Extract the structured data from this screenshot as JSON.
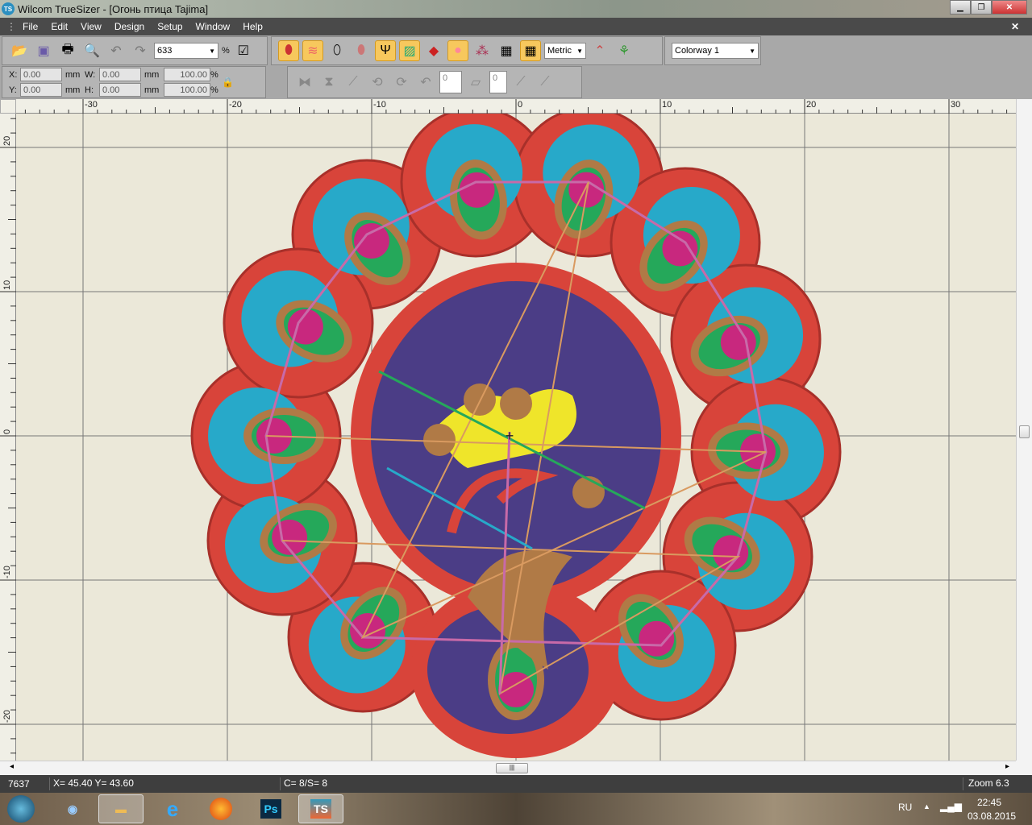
{
  "window": {
    "title": "Wilcom TrueSizer - [Огонь птица          Tajima]",
    "logo": "TS"
  },
  "menu": [
    "File",
    "Edit",
    "View",
    "Design",
    "Setup",
    "Window",
    "Help"
  ],
  "toolbar": {
    "zoom_value": "633",
    "zoom_unit": "%",
    "units": "Metric",
    "colorway": "Colorway 1"
  },
  "transform": {
    "x_label": "X:",
    "x": "0.00",
    "y_label": "Y:",
    "y": "0.00",
    "w_label": "W:",
    "w": "0.00",
    "h_label": "H:",
    "h": "0.00",
    "unit": "mm",
    "w_pct": "100.00",
    "h_pct": "100.00",
    "pct": "%",
    "rotate": "0",
    "slant": "0"
  },
  "ruler": {
    "top": [
      "-30",
      "-20",
      "-10",
      "0",
      "10",
      "20",
      "30"
    ],
    "left": [
      "20",
      "10",
      "0",
      "-10",
      "-20"
    ]
  },
  "status": {
    "stitches": "7637",
    "coords": "X=  45.40 Y=  43.60",
    "colors": "C=  8/S=  8",
    "zoom": "Zoom 6.3"
  },
  "taskbar": {
    "lang": "RU",
    "time": "22:45",
    "date": "03.08.2015",
    "apps": [
      "Start",
      "Explorer",
      "Internet Explorer",
      "Firefox",
      "Ps",
      "TS"
    ]
  },
  "colors": {
    "red": "#d8443a",
    "cyan": "#27a9c9",
    "purple": "#4b3d86",
    "magenta": "#c8287e",
    "green": "#25a85a",
    "brown": "#b07a46",
    "yellow": "#efe52a",
    "canvas": "#ebe8d9"
  }
}
